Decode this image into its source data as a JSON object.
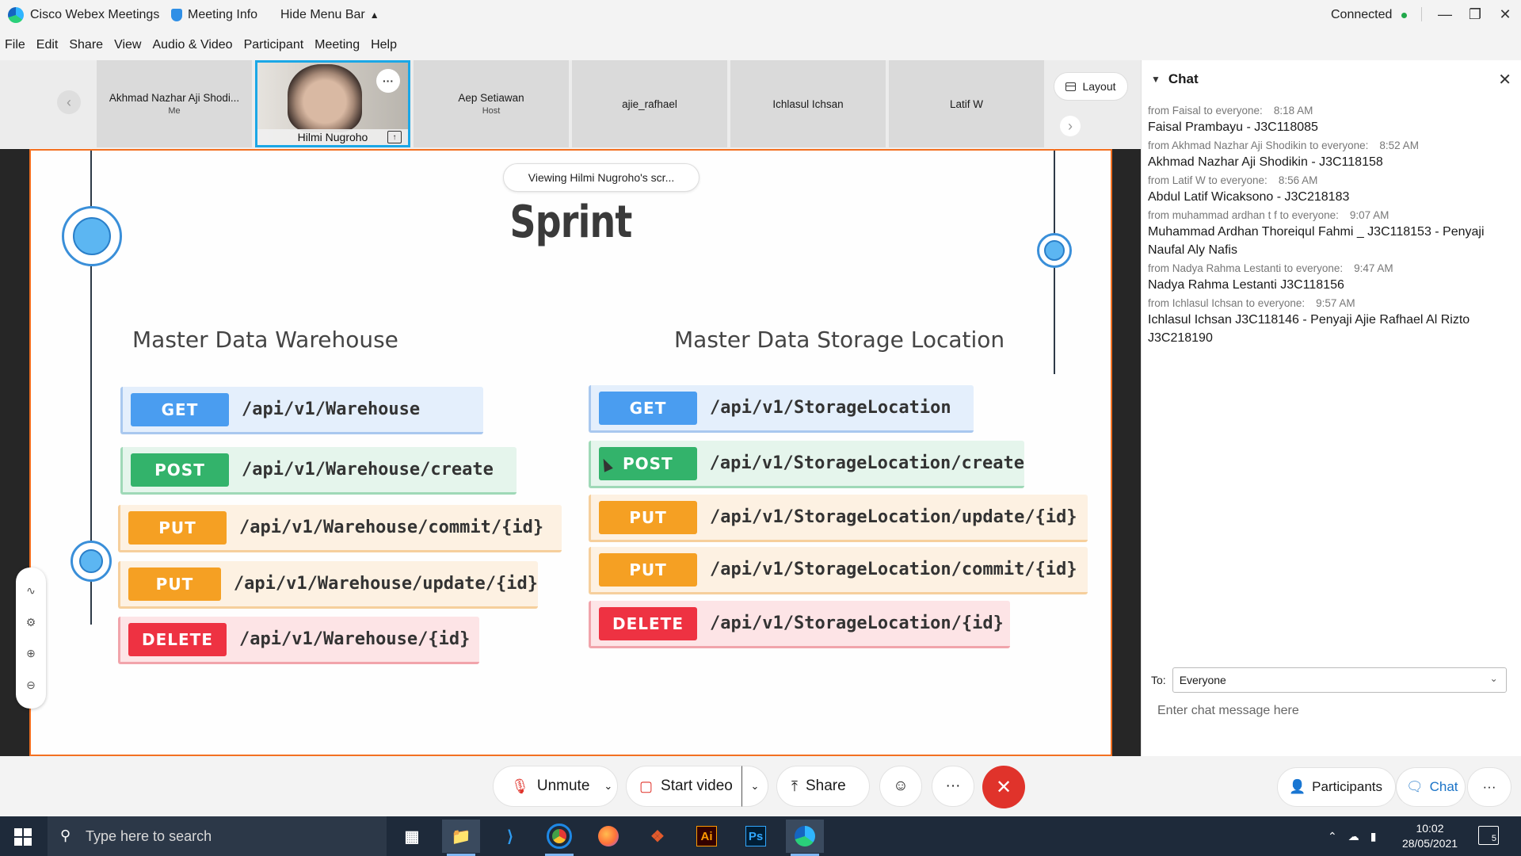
{
  "titlebar": {
    "app_name": "Cisco Webex Meetings",
    "meeting_info": "Meeting Info",
    "hide_menu": "Hide Menu Bar",
    "status": "Connected"
  },
  "menu": [
    "File",
    "Edit",
    "Share",
    "View",
    "Audio & Video",
    "Participant",
    "Meeting",
    "Help"
  ],
  "participants": [
    {
      "name": "Akhmad Nazhar Aji Shodi...",
      "role": "Me"
    },
    {
      "name": "Hilmi Nugroho",
      "role": ""
    },
    {
      "name": "Aep Setiawan",
      "role": "Host"
    },
    {
      "name": "ajie_rafhael",
      "role": ""
    },
    {
      "name": "Ichlasul Ichsan",
      "role": ""
    },
    {
      "name": "Latif W",
      "role": ""
    }
  ],
  "layout_button": "Layout",
  "slide": {
    "viewing": "Viewing Hilmi Nugroho's scr...",
    "title": "Sprint",
    "left_heading": "Master Data Warehouse",
    "right_heading": "Master Data Storage Location",
    "left_rows": [
      {
        "method": "GET",
        "path": "/api/v1/Warehouse"
      },
      {
        "method": "POST",
        "path": "/api/v1/Warehouse/create"
      },
      {
        "method": "PUT",
        "path": "/api/v1/Warehouse/commit/{id}"
      },
      {
        "method": "PUT",
        "path": "/api/v1/Warehouse/update/{id}"
      },
      {
        "method": "DELETE",
        "path": "/api/v1/Warehouse/{id}"
      }
    ],
    "right_rows": [
      {
        "method": "GET",
        "path": "/api/v1/StorageLocation"
      },
      {
        "method": "POST",
        "path": "/api/v1/StorageLocation/create"
      },
      {
        "method": "PUT",
        "path": "/api/v1/StorageLocation/update/{id}"
      },
      {
        "method": "PUT",
        "path": "/api/v1/StorageLocation/commit/{id}"
      },
      {
        "method": "DELETE",
        "path": "/api/v1/StorageLocation/{id}"
      }
    ]
  },
  "chat": {
    "title": "Chat",
    "messages": [
      {
        "from": "from Faisal to everyone:",
        "time": "8:18 AM",
        "text": "Faisal Prambayu - J3C118085"
      },
      {
        "from": "from Akhmad Nazhar Aji Shodikin to everyone:",
        "time": "8:52 AM",
        "text": "Akhmad Nazhar Aji Shodikin - J3C118158"
      },
      {
        "from": "from Latif W to everyone:",
        "time": "8:56 AM",
        "text": "Abdul Latif Wicaksono - J3C218183"
      },
      {
        "from": "from muhammad ardhan t f to everyone:",
        "time": "9:07 AM",
        "text": "Muhammad Ardhan Thoreiqul Fahmi _ J3C118153 - Penyaji Naufal Aly Nafis"
      },
      {
        "from": "from Nadya Rahma Lestanti to everyone:",
        "time": "9:47 AM",
        "text": "Nadya Rahma Lestanti J3C118156"
      },
      {
        "from": "from Ichlasul Ichsan to everyone:",
        "time": "9:57 AM",
        "text": "Ichlasul Ichsan J3C118146 - Penyaji Ajie Rafhael Al Rizto J3C218190"
      }
    ],
    "to_label": "To:",
    "to_value": "Everyone",
    "input_placeholder": "Enter chat message here"
  },
  "controls": {
    "unmute": "Unmute",
    "start_video": "Start video",
    "share": "Share",
    "participants": "Participants",
    "chat": "Chat"
  },
  "taskbar": {
    "search_placeholder": "Type here to search",
    "time": "10:02",
    "date": "28/05/2021",
    "notifications": "5"
  },
  "colors": {
    "accent": "#1ba7e6",
    "share_border": "#f37021",
    "end_call": "#e0332b",
    "get": "#4a9df0",
    "post": "#33b36b",
    "put": "#f5a023",
    "delete": "#ee3242"
  }
}
